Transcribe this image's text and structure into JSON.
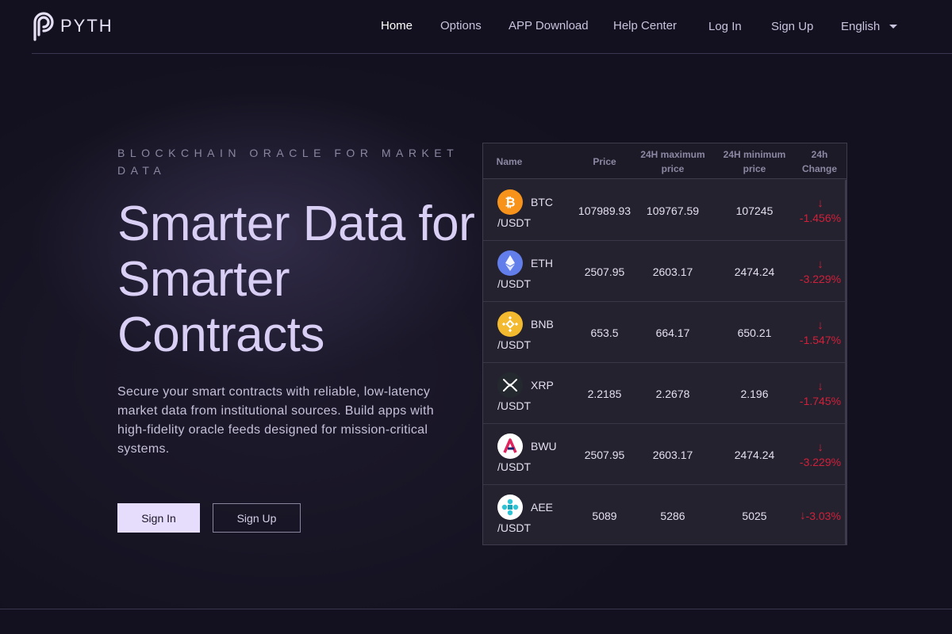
{
  "brand": {
    "name": "PYTH"
  },
  "nav": {
    "items": [
      {
        "label": "Home",
        "active": true
      },
      {
        "label": "Options"
      },
      {
        "label": "APP Download"
      },
      {
        "label": "Help Center"
      }
    ],
    "login": "Log In",
    "signup": "Sign Up",
    "language": "English"
  },
  "hero": {
    "eyebrow": "BLOCKCHAIN ORACLE FOR MARKET DATA",
    "headline": "Smarter Data for Smarter Contracts",
    "subtext": "Secure your smart contracts with reliable, low-latency market data from institutional sources. Build apps with high-fidelity oracle feeds designed for mission-critical systems.",
    "primary_button": "Sign In",
    "secondary_button": "Sign Up"
  },
  "market_table": {
    "columns": [
      "Name",
      "Price",
      "24H maximum price",
      "24H minimum price",
      "24h Change"
    ],
    "rows": [
      {
        "symbol": "BTC",
        "quote": "/USDT",
        "price": "107989.93",
        "high": "109767.59",
        "low": "107245",
        "change": "-1.456%",
        "direction": "down",
        "icon": "bitcoin-icon",
        "color": "#f7931a"
      },
      {
        "symbol": "ETH",
        "quote": "/USDT",
        "price": "2507.95",
        "high": "2603.17",
        "low": "2474.24",
        "change": "-3.229%",
        "direction": "down",
        "icon": "ethereum-icon",
        "color": "#627eea"
      },
      {
        "symbol": "BNB",
        "quote": "/USDT",
        "price": "653.5",
        "high": "664.17",
        "low": "650.21",
        "change": "-1.547%",
        "direction": "down",
        "icon": "bnb-icon",
        "color": "#f3ba2f"
      },
      {
        "symbol": "XRP",
        "quote": "/USDT",
        "price": "2.2185",
        "high": "2.2678",
        "low": "2.196",
        "change": "-1.745%",
        "direction": "down",
        "icon": "xrp-icon",
        "color": "#23292f"
      },
      {
        "symbol": "BWU",
        "quote": "/USDT",
        "price": "2507.95",
        "high": "2603.17",
        "low": "2474.24",
        "change": "-3.229%",
        "direction": "down",
        "icon": "bwu-icon",
        "color": "#ffffff"
      },
      {
        "symbol": "AEE",
        "quote": "/USDT",
        "price": "5089",
        "high": "5286",
        "low": "5025",
        "change": "-3.03%",
        "direction": "down",
        "icon": "aee-icon",
        "color": "#ffffff"
      }
    ],
    "down_color": "#d0203a"
  }
}
